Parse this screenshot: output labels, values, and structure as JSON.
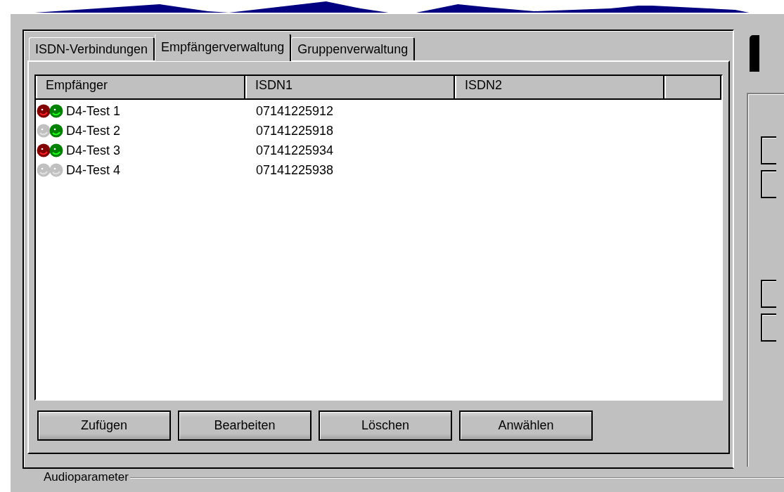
{
  "tabs": [
    {
      "label": "ISDN-Verbindungen",
      "selected": false
    },
    {
      "label": "Empfängerverwaltung",
      "selected": true
    },
    {
      "label": "Gruppenverwaltung",
      "selected": false
    }
  ],
  "table": {
    "columns": [
      "Empfänger",
      "ISDN1",
      "ISDN2"
    ],
    "rows": [
      {
        "name": "D4-Test 1",
        "isdn1": "07141225912",
        "red_on": true,
        "green_on": true
      },
      {
        "name": "D4-Test 2",
        "isdn1": "07141225918",
        "red_on": false,
        "green_on": true
      },
      {
        "name": "D4-Test 3",
        "isdn1": "07141225934",
        "red_on": true,
        "green_on": true
      },
      {
        "name": "D4-Test 4",
        "isdn1": "07141225938",
        "red_on": false,
        "green_on": false
      }
    ]
  },
  "buttons": [
    "Zufügen",
    "Bearbeiten",
    "Löschen",
    "Anwählen"
  ],
  "group_label": "Audioparameter"
}
